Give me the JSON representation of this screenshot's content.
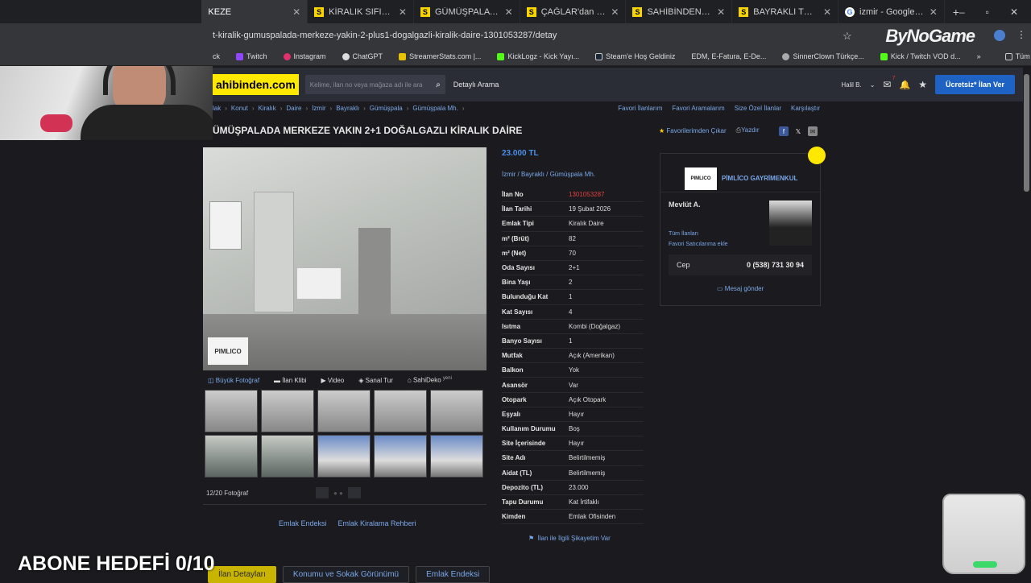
{
  "tabs": [
    {
      "title": "KEZE",
      "active": true
    },
    {
      "title": "KİRALIK SIFIR DAİRE BAYR"
    },
    {
      "title": "GÜMÜŞPALA ÇARŞIYA YA"
    },
    {
      "title": "ÇAĞLAR'dan Kiralık doğal"
    },
    {
      "title": "SAHİBİNDEN NALDÖKEN"
    },
    {
      "title": "BAYRAKLI TURANda Yeni"
    },
    {
      "title": "izmir - Google'da Ara"
    }
  ],
  "window_buttons": {
    "new_tab": "+",
    "minimize": "–",
    "maximize": "▫",
    "close": "✕"
  },
  "url": "t-kiralik-gumuspalada-merkeze-yakin-2-plus1-dogalgazli-kiralik-daire-1301053287/detay",
  "brand_overlay": "ByNoGame",
  "bookmarks": [
    "ck",
    "Twitch",
    "Instagram",
    "ChatGPT",
    "StreamerStats.com |...",
    "KickLogz - Kick Yayı...",
    "Steam'e Hoş Geldiniz",
    "EDM, E-Fatura, E-De...",
    "SinnerClown Türkçe...",
    "Kick / Twitch VOD d..."
  ],
  "bookmarks_overflow": "»",
  "bookmarks_all": "Tüm Yer İşaretleri",
  "site": {
    "logo": "ahibinden.com",
    "search_placeholder": "Kelime, ilan no veya mağaza adı ile ara",
    "detailed_search": "Detaylı Arama",
    "user": "Halil B.",
    "badge": "7",
    "post_button": "Ücretsiz* İlan Ver"
  },
  "breadcrumb": [
    "lak",
    "Konut",
    "Kiralık",
    "Daire",
    "İzmir",
    "Bayraklı",
    "Gümüşpala",
    "Gümüşpala Mh."
  ],
  "breadcrumb_sep": "›",
  "top_links": [
    "Favori İlanlarım",
    "Favori Aramalarım",
    "Size Özel İlanlar",
    "Karşılaştır"
  ],
  "title": "ÜMÜŞPALADA MERKEZE YAKIN 2+1 DOĞALGAZLI KİRALIK DAİRE",
  "title_actions": {
    "fav": "Favorilerimden Çıkar",
    "print": "Yazdır"
  },
  "photo_watermark": "PIMLICO",
  "photo_tabs": [
    "Büyük Fotoğraf",
    "İlan Klibi",
    "Video",
    "Sanal Tur",
    "SahiDeko"
  ],
  "sahideko_badge": "yeni",
  "photo_counter": "12/20 Fotoğraf",
  "bottom_links": [
    "Emlak Endeksi",
    "Emlak Kiralama Rehberi"
  ],
  "price": "23.000 TL",
  "location": "İzmir  /  Bayraklı  /  Gümüşpala Mh.",
  "properties": [
    {
      "k": "İlan No",
      "v": "1301053287"
    },
    {
      "k": "İlan Tarihi",
      "v": "19 Şubat 2026"
    },
    {
      "k": "Emlak Tipi",
      "v": "Kiralık Daire"
    },
    {
      "k": "m² (Brüt)",
      "v": "82"
    },
    {
      "k": "m² (Net)",
      "v": "70"
    },
    {
      "k": "Oda Sayısı",
      "v": "2+1"
    },
    {
      "k": "Bina Yaşı",
      "v": "2"
    },
    {
      "k": "Bulunduğu Kat",
      "v": "1"
    },
    {
      "k": "Kat Sayısı",
      "v": "4"
    },
    {
      "k": "Isıtma",
      "v": "Kombi (Doğalgaz)"
    },
    {
      "k": "Banyo Sayısı",
      "v": "1"
    },
    {
      "k": "Mutfak",
      "v": "Açık (Amerikan)"
    },
    {
      "k": "Balkon",
      "v": "Yok"
    },
    {
      "k": "Asansör",
      "v": "Var"
    },
    {
      "k": "Otopark",
      "v": "Açık Otopark"
    },
    {
      "k": "Eşyalı",
      "v": "Hayır"
    },
    {
      "k": "Kullanım Durumu",
      "v": "Boş"
    },
    {
      "k": "Site İçerisinde",
      "v": "Hayır"
    },
    {
      "k": "Site Adı",
      "v": "Belirtilmemiş"
    },
    {
      "k": "Aidat (TL)",
      "v": "Belirtilmemiş"
    },
    {
      "k": "Depozito (TL)",
      "v": "23.000"
    },
    {
      "k": "Tapu Durumu",
      "v": "Kat İrtifaklı"
    },
    {
      "k": "Kimden",
      "v": "Emlak Ofisinden"
    }
  ],
  "complaint": "İlan ile İlgili Şikayetim Var",
  "seller": {
    "logo": "PIMLICO",
    "agency": "PİMLİCO GAYRİMENKUL",
    "agent": "Mevlüt A.",
    "all_ads": "Tüm İlanları",
    "fav_seller": "Favori Satıcılarıma ekle",
    "phone_label": "Cep",
    "phone": "0 (538) 731 30 94",
    "message": "Mesaj gönder"
  },
  "bottom_tabs": [
    "İlan Detayları",
    "Konumu ve Sokak Görünümü",
    "Emlak Endeksi"
  ],
  "overlay_text": "ABONE HEDEFİ 0/10",
  "colors": {
    "accent": "#1e63c4",
    "link": "#7aa7e8",
    "brand_yellow": "#ffe800"
  }
}
